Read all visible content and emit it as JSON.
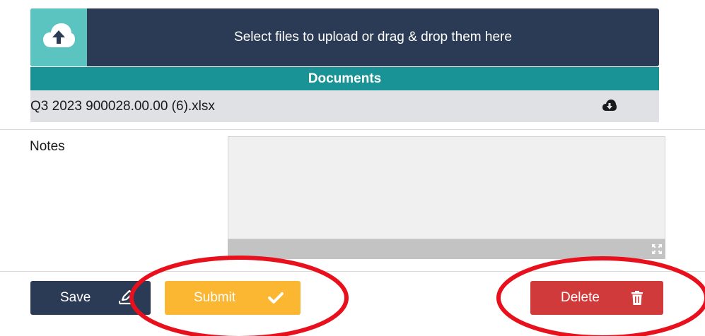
{
  "upload": {
    "prompt": "Select files to upload or drag & drop them here",
    "icon": "cloud-upload-icon"
  },
  "documents": {
    "header": "Documents",
    "files": [
      {
        "name": "Q3 2023 900028.00.00 (6).xlsx",
        "icon": "cloud-download-icon"
      }
    ]
  },
  "notes": {
    "label": "Notes",
    "value": "",
    "resize_icon": "expand-icon"
  },
  "actions": {
    "save_label": "Save",
    "save_icon": "edit-sign-icon",
    "submit_label": "Submit",
    "submit_icon": "checkmark-icon",
    "delete_label": "Delete",
    "delete_icon": "trash-icon"
  },
  "colors": {
    "navy": "#2b3a55",
    "teal": "#1a9396",
    "aqua": "#5bc4c0",
    "submit": "#fbb632",
    "delete": "#d03a3a",
    "annotation": "#e8101c"
  }
}
